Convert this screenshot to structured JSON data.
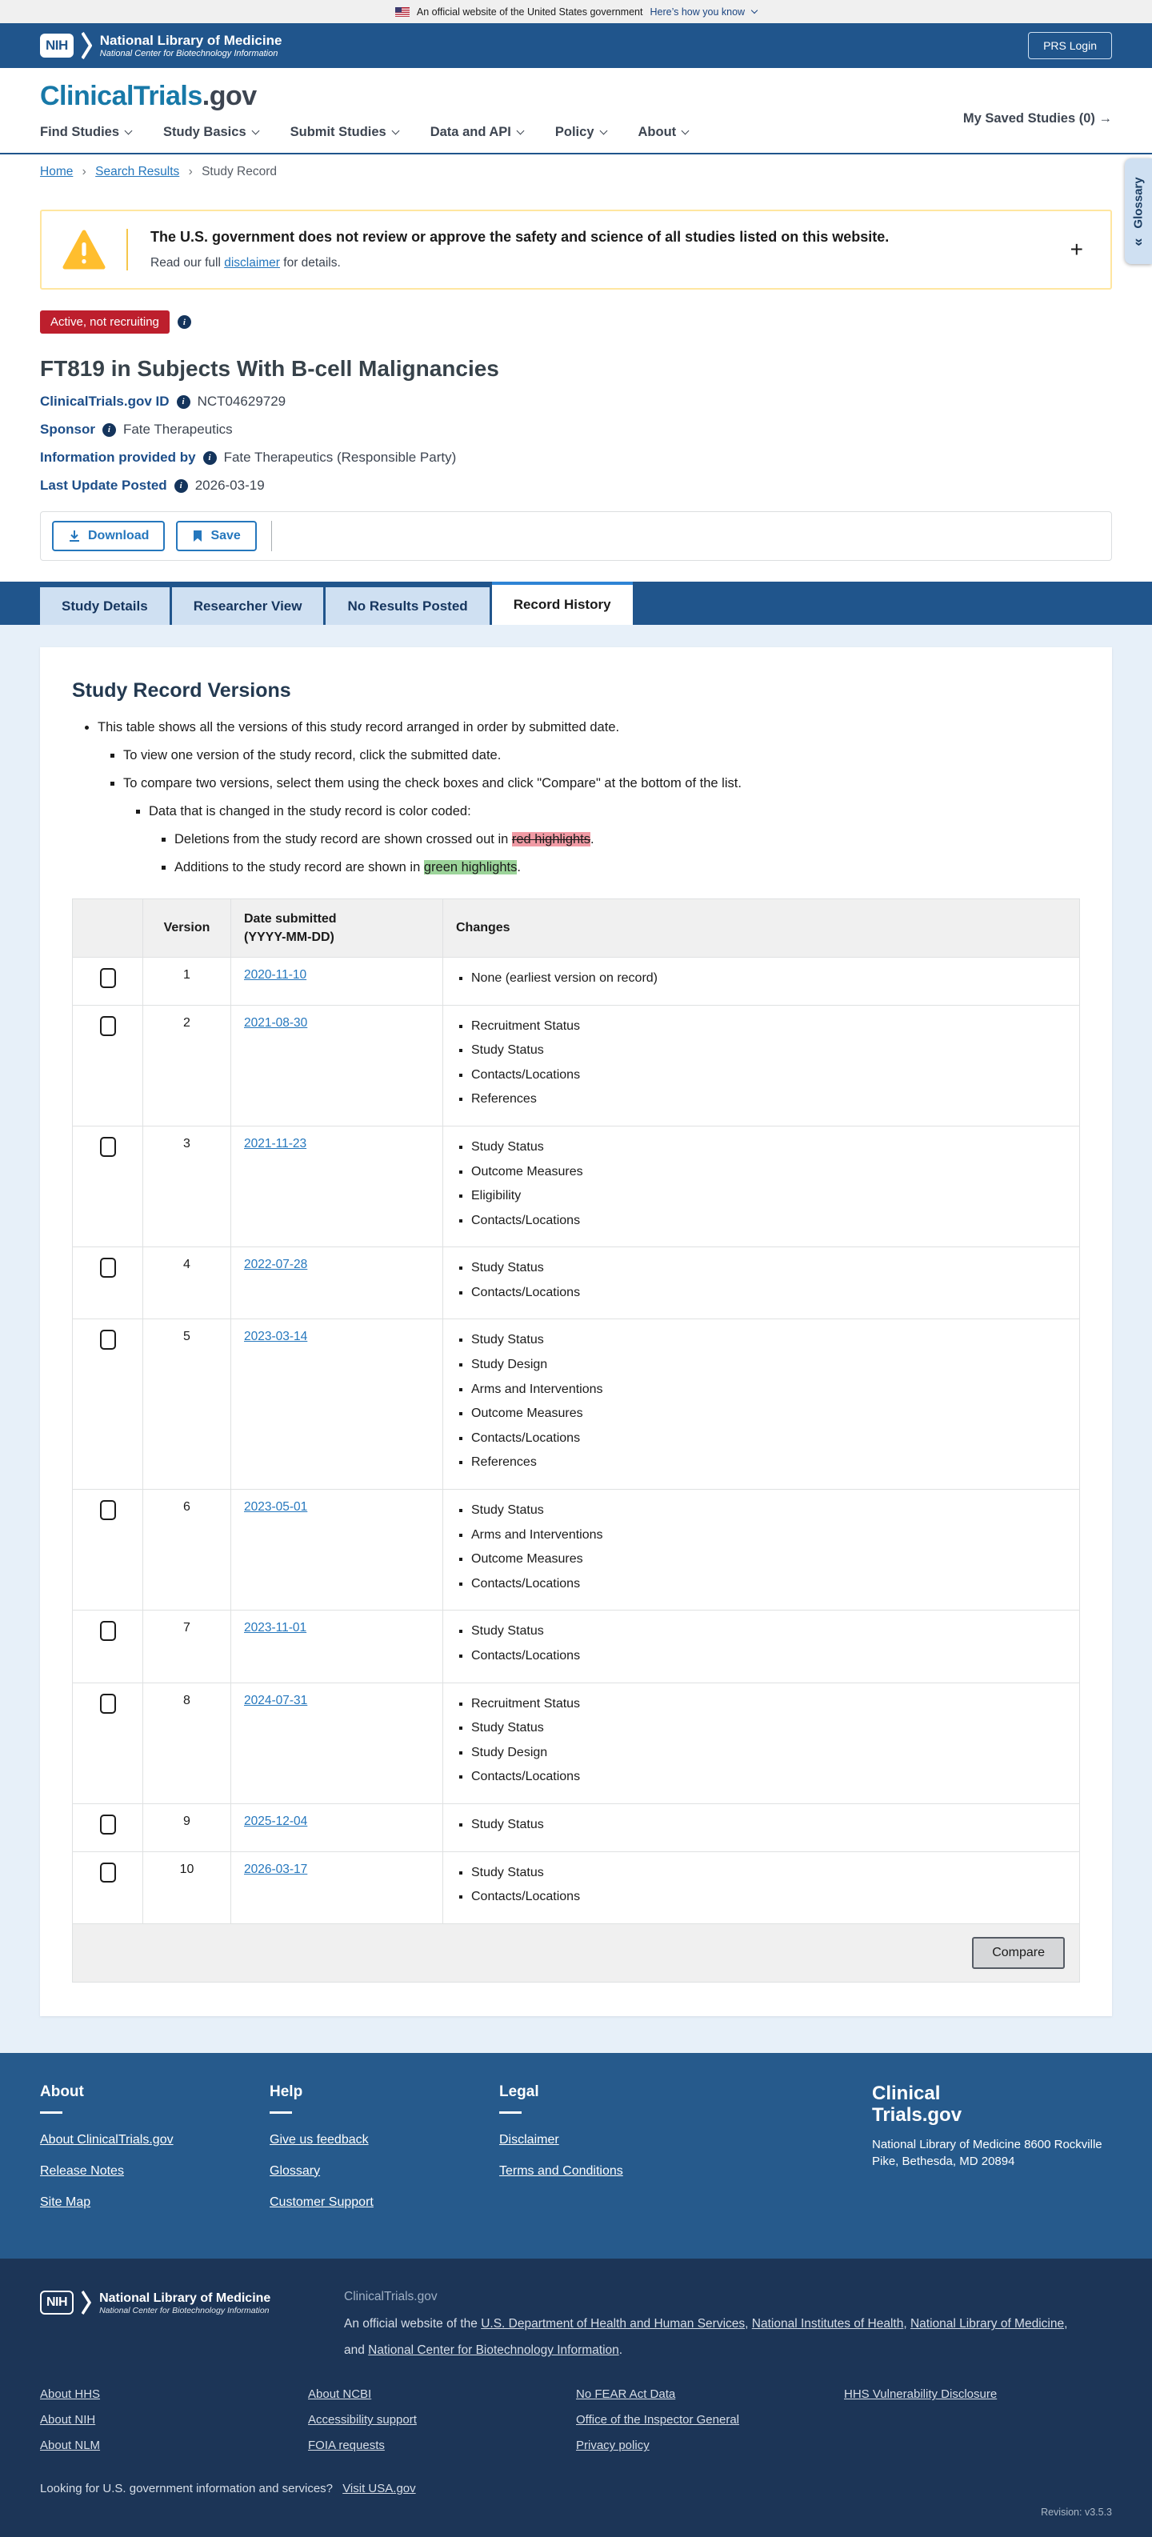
{
  "gov_banner": {
    "text": "An official website of the United States government",
    "link": "Here’s how you know"
  },
  "nih_header": {
    "logo_acronym": "NIH",
    "org_name": "National Library of Medicine",
    "org_sub": "National Center for Biotechnology Information",
    "login_label": "PRS Login"
  },
  "site_header": {
    "logo_primary": "ClinicalTrials",
    "logo_suffix": ".gov",
    "nav": [
      "Find Studies",
      "Study Basics",
      "Submit Studies",
      "Data and API",
      "Policy",
      "About"
    ],
    "saved_label": "My Saved Studies (0) →"
  },
  "breadcrumb": {
    "home": "Home",
    "search_results": "Search Results",
    "current": "Study Record"
  },
  "glossary_tab": {
    "label": "Glossary",
    "collapse_icon": "«"
  },
  "warning": {
    "headline": "The U.S. government does not review or approve the safety and science of all studies listed on this website.",
    "sub_prefix": "Read our full ",
    "link": "disclaimer",
    "sub_suffix": " for details.",
    "expand_icon": "+"
  },
  "study": {
    "status": "Active, not recruiting",
    "title": "FT819 in Subjects With B-cell Malignancies",
    "meta": [
      {
        "label": "ClinicalTrials.gov ID",
        "value": "NCT04629729"
      },
      {
        "label": "Sponsor",
        "value": "Fate Therapeutics"
      },
      {
        "label": "Information provided by",
        "value": "Fate Therapeutics (Responsible Party)"
      },
      {
        "label": "Last Update Posted",
        "value": "2026-03-19"
      }
    ]
  },
  "actions": {
    "download": "Download",
    "save": "Save"
  },
  "tabs": [
    "Study Details",
    "Researcher View",
    "No Results Posted",
    "Record History"
  ],
  "record_versions": {
    "heading": "Study Record Versions",
    "notes": {
      "l1": "This table shows all the versions of this study record arranged in order by submitted date.",
      "l2a": "To view one version of the study record, click the submitted date.",
      "l2b": "To compare two versions, select them using the check boxes and click \"Compare\" at the bottom of the list.",
      "l3": "Data that is changed in the study record is color coded:",
      "l4a_prefix": "Deletions from the study record are shown crossed out in ",
      "l4a_mark": "red highlights",
      "l4a_suffix": ".",
      "l4b_prefix": "Additions to the study record are shown in ",
      "l4b_mark": "green highlights",
      "l4b_suffix": "."
    },
    "table": {
      "headers": {
        "version": "Version",
        "date_line1": "Date submitted",
        "date_line2": "(YYYY-MM-DD)",
        "changes": "Changes"
      },
      "rows": [
        {
          "version": "1",
          "date": "2020-11-10",
          "changes": [
            "None (earliest version on record)"
          ]
        },
        {
          "version": "2",
          "date": "2021-08-30",
          "changes": [
            "Recruitment Status",
            "Study Status",
            "Contacts/Locations",
            "References"
          ]
        },
        {
          "version": "3",
          "date": "2021-11-23",
          "changes": [
            "Study Status",
            "Outcome Measures",
            "Eligibility",
            "Contacts/Locations"
          ]
        },
        {
          "version": "4",
          "date": "2022-07-28",
          "changes": [
            "Study Status",
            "Contacts/Locations"
          ]
        },
        {
          "version": "5",
          "date": "2023-03-14",
          "changes": [
            "Study Status",
            "Study Design",
            "Arms and Interventions",
            "Outcome Measures",
            "Contacts/Locations",
            "References"
          ]
        },
        {
          "version": "6",
          "date": "2023-05-01",
          "changes": [
            "Study Status",
            "Arms and Interventions",
            "Outcome Measures",
            "Contacts/Locations"
          ]
        },
        {
          "version": "7",
          "date": "2023-11-01",
          "changes": [
            "Study Status",
            "Contacts/Locations"
          ]
        },
        {
          "version": "8",
          "date": "2024-07-31",
          "changes": [
            "Recruitment Status",
            "Study Status",
            "Study Design",
            "Contacts/Locations"
          ]
        },
        {
          "version": "9",
          "date": "2025-12-04",
          "changes": [
            "Study Status"
          ]
        },
        {
          "version": "10",
          "date": "2026-03-17",
          "changes": [
            "Study Status",
            "Contacts/Locations"
          ]
        }
      ],
      "compare_label": "Compare"
    }
  },
  "footer": {
    "columns": [
      {
        "heading": "About",
        "links": [
          "About ClinicalTrials.gov",
          "Release Notes",
          "Site Map"
        ]
      },
      {
        "heading": "Help",
        "links": [
          "Give us feedback",
          "Glossary",
          "Customer Support"
        ]
      },
      {
        "heading": "Legal",
        "links": [
          "Disclaimer",
          "Terms and Conditions"
        ]
      }
    ],
    "brand_line1": "Clinical",
    "brand_line2": "Trials.gov",
    "address": "National Library of Medicine 8600 Rockville Pike, Bethesda, MD 20894"
  },
  "nlm_footer": {
    "logo_acronym": "NIH",
    "org_name": "National Library of Medicine",
    "org_sub": "National Center for Biotechnology Information",
    "ct_label": "ClinicalTrials.gov",
    "official_prefix": "An official website of the ",
    "link_hhs": "U.S. Department of Health and Human Services",
    "sep1": ", ",
    "link_nih": "National Institutes of Health",
    "sep2": ", ",
    "link_nlm": "National Library of Medicine",
    "sep3": ", and ",
    "link_ncbi": "National Center for Biotechnology Information",
    "period": ".",
    "link_columns": [
      {
        "links": [
          "About HHS",
          "About NIH",
          "About NLM"
        ]
      },
      {
        "links": [
          "About NCBI",
          "Accessibility support",
          "FOIA requests"
        ]
      },
      {
        "links": [
          "No FEAR Act Data",
          "Office of the Inspector General",
          "Privacy policy"
        ]
      },
      {
        "links": [
          "HHS Vulnerability Disclosure"
        ]
      }
    ],
    "bottom_text": "Looking for U.S. government information and services?",
    "bottom_link": "Visit USA.gov",
    "revision": "Revision: v3.5.3"
  },
  "colors": {
    "header_blue": "#20558c",
    "footer_blue": "#265a8c",
    "nlm_navy": "#1c3557",
    "link_blue": "#2577bd",
    "status_red": "#bd1f2d",
    "tab_inactive": "#cfe0f2",
    "active_tab_accent": "#2e84d5",
    "warning_yellow": "#ffbe2e",
    "deletion_highlight": "#f09aa4",
    "addition_highlight": "#9cd49a",
    "page_light_blue": "#e7f0f9"
  }
}
